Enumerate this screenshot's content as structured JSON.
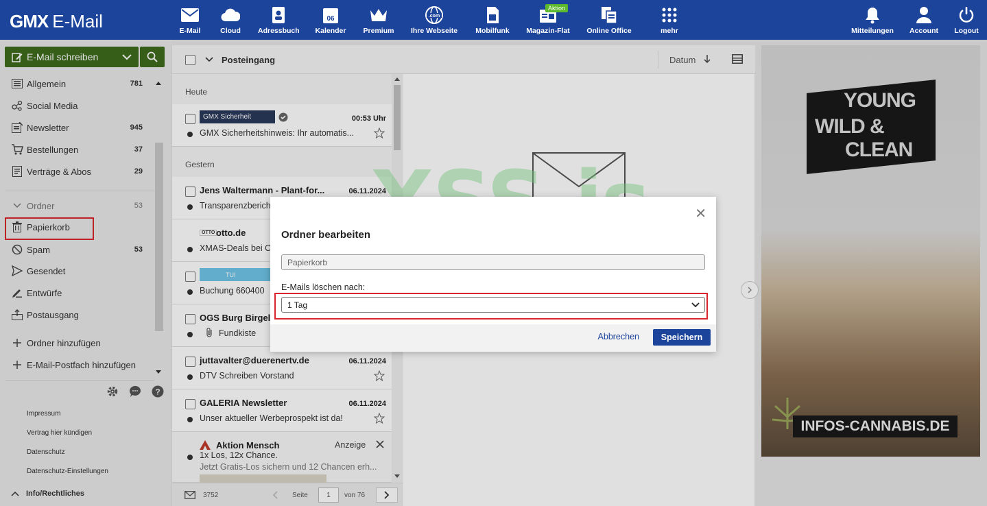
{
  "header": {
    "brand": "GMX",
    "product": "E-Mail",
    "nav": [
      {
        "label": "E-Mail",
        "icon": "envelope-icon"
      },
      {
        "label": "Cloud",
        "icon": "cloud-icon"
      },
      {
        "label": "Adressbuch",
        "icon": "addressbook-icon"
      },
      {
        "label": "Kalender",
        "icon": "calendar-icon",
        "day": "06"
      },
      {
        "label": "Premium",
        "icon": "crown-icon"
      },
      {
        "label": "Ihre Webseite",
        "icon": "globe-icon",
        "text": ".com"
      },
      {
        "label": "Mobilfunk",
        "icon": "sim-card-icon"
      },
      {
        "label": "Magazin-Flat",
        "icon": "magazine-icon",
        "badge": "Aktion"
      },
      {
        "label": "Online Office",
        "icon": "office-icon"
      },
      {
        "label": "mehr",
        "icon": "grid-icon"
      }
    ],
    "right": [
      {
        "label": "Mitteilungen",
        "icon": "bell-icon"
      },
      {
        "label": "Account",
        "icon": "user-icon"
      },
      {
        "label": "Logout",
        "icon": "power-icon"
      }
    ]
  },
  "sidebar": {
    "compose_label": "E-Mail schreiben",
    "folders": [
      {
        "label": "Allgemein",
        "count": "781"
      },
      {
        "label": "Social Media",
        "count": ""
      },
      {
        "label": "Newsletter",
        "count": "945"
      },
      {
        "label": "Bestellungen",
        "count": "37"
      },
      {
        "label": "Verträge & Abos",
        "count": "29"
      }
    ],
    "ordner": {
      "label": "Ordner",
      "count": "53"
    },
    "subfolders": [
      {
        "label": "Papierkorb",
        "count": ""
      },
      {
        "label": "Spam",
        "count": "53"
      },
      {
        "label": "Gesendet",
        "count": ""
      },
      {
        "label": "Entwürfe",
        "count": ""
      },
      {
        "label": "Postausgang",
        "count": ""
      }
    ],
    "add_folder": "Ordner hinzufügen",
    "add_mailbox": "E-Mail-Postfach hinzufügen",
    "footer_links": [
      "Impressum",
      "Vertrag hier kündigen",
      "Datenschutz",
      "Datenschutz-Einstellungen"
    ],
    "info": "Info/Rechtliches"
  },
  "maillist": {
    "folder_title": "Posteingang",
    "sort_label": "Datum",
    "groups": [
      "Heute",
      "Gestern"
    ],
    "mails": [
      {
        "from": "GMX Sicherheit",
        "date": "00:53 Uhr",
        "subject": "GMX Sicherheitshinweis: Ihr automatis..."
      },
      {
        "from": "Jens Waltermann - Plant-for...",
        "date": "06.11.2024",
        "subject": "Transparenzbericht"
      },
      {
        "from": "otto.de",
        "date": "",
        "subject": "XMAS-Deals bei OTTO"
      },
      {
        "from": "TUI",
        "date": "",
        "subject": "Buchung 660400"
      },
      {
        "from": "OGS Burg Birgel",
        "date": "",
        "subject": "Fundkiste"
      },
      {
        "from": "juttavalter@duerenertv.de",
        "date": "06.11.2024",
        "subject": "DTV Schreiben Vorstand"
      },
      {
        "from": "GALERIA Newsletter",
        "date": "06.11.2024",
        "subject": "Unser aktueller Werbeprospekt ist da!"
      },
      {
        "from": "Aktion Mensch",
        "date": "Anzeige",
        "subject": "1x Los, 12x Chance.",
        "preview": "Jetzt Gratis-Los sichern und 12 Chancen erh..."
      }
    ],
    "pager": {
      "total": "3752",
      "page_label": "Seite",
      "page": "1",
      "of_label": "von 76"
    }
  },
  "ad": {
    "line1": "YOUNG",
    "line2": "WILD &",
    "line3": "CLEAN",
    "footer": "INFOS-CANNABIS.DE"
  },
  "watermark": "XSS.is",
  "dialog": {
    "title": "Ordner bearbeiten",
    "name_value": "Papierkorb",
    "delete_label": "E-Mails löschen nach:",
    "delete_value": "1 Tag",
    "cancel": "Abbrechen",
    "save": "Speichern"
  },
  "colors": {
    "brand": "#1c449b",
    "compose": "#3e6b1d",
    "highlight": "#d9262e",
    "watermark": "#74c47a"
  }
}
